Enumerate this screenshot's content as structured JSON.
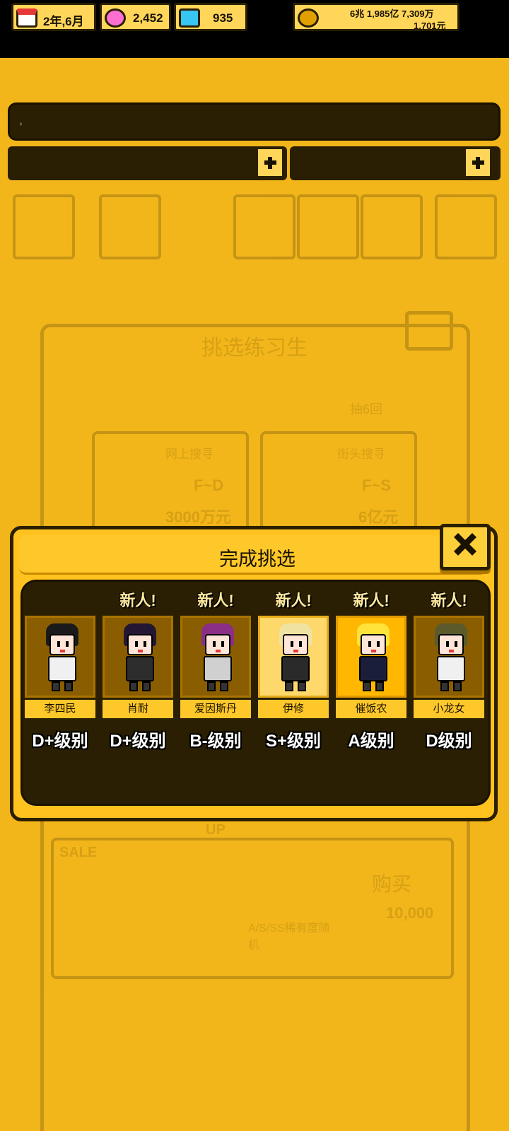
{
  "top_bar": {
    "ticker_text": "›"
  },
  "resources": {
    "date": "2年,6月",
    "gems_pink": "2,452",
    "gems_blue": "935",
    "money_line1": "6兆 1,985亿 7,309万",
    "money_line2": "1,701元"
  },
  "background": {
    "title": "挑选练习生",
    "draw_label": "抽6回",
    "card1_label": "网上搜寻",
    "card1_range": "F~D",
    "card1_price": "3000万元",
    "card2_label": "街头搜寻",
    "card2_range": "F~S",
    "card2_price": "6亿元",
    "sale_label": "SALE",
    "up_label": "UP",
    "rarity_label": "A/S/SS稀有度随机",
    "buy_label": "购买",
    "buy_price": "10,000"
  },
  "modal": {
    "title": "完成挑选",
    "characters": [
      {
        "name": "李四民",
        "grade": "D+级别",
        "new": "",
        "hair": "#1a1a1a",
        "body": "#f0f0f0"
      },
      {
        "name": "肖耐",
        "grade": "D+级别",
        "new": "新人!",
        "hair": "#241733",
        "body": "#2d2d2d"
      },
      {
        "name": "爱因斯丹",
        "grade": "B-级别",
        "new": "新人!",
        "hair": "#8b2e86",
        "body": "#d0d0d0"
      },
      {
        "name": "伊修",
        "grade": "S+级别",
        "new": "新人!",
        "hair": "#f0e2a0",
        "body": "#2a2a2a"
      },
      {
        "name": "催饭农",
        "grade": "A级别",
        "new": "新人!",
        "hair": "#ffe23a",
        "body": "#1b1e3a"
      },
      {
        "name": "小龙女",
        "grade": "D级别",
        "new": "新人!",
        "hair": "#5a5a2c",
        "body": "#f0f0f0"
      }
    ]
  },
  "colors": {
    "background": "#f2b61b",
    "modal": "#ffc21f",
    "dark": "#2a1f02"
  }
}
